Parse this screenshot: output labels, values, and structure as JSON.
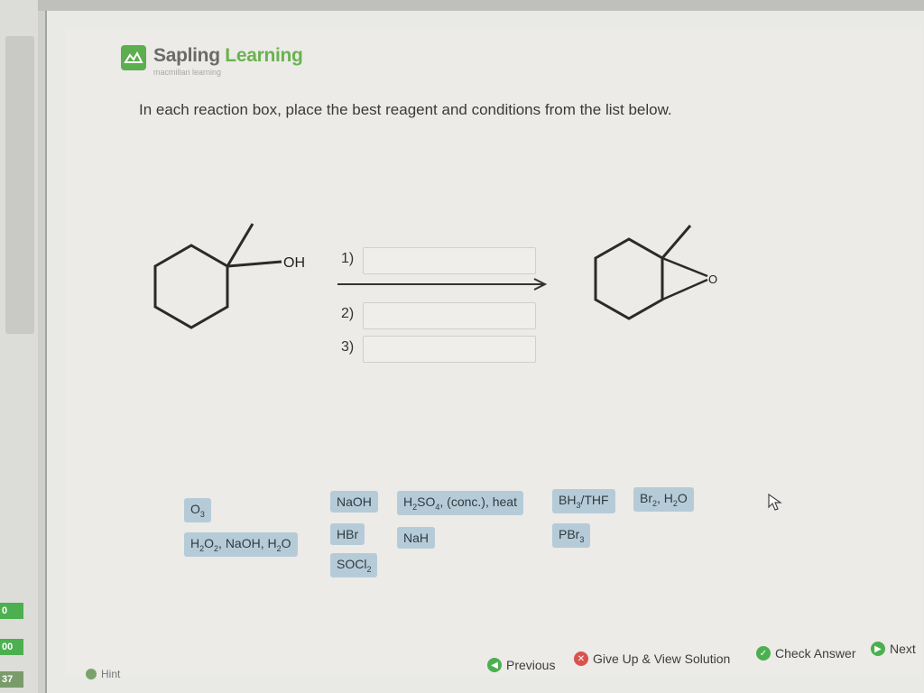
{
  "brand": {
    "name_part1": "Sapling",
    "name_part2": "Learning",
    "tagline": "macmillan learning"
  },
  "question": {
    "prompt": "In each reaction box, place the best reagent and conditions from the list below."
  },
  "reaction": {
    "reactant_label": "OH",
    "product_label": "O",
    "steps": [
      {
        "label": "1)",
        "value": ""
      },
      {
        "label": "2)",
        "value": ""
      },
      {
        "label": "3)",
        "value": ""
      }
    ]
  },
  "reagents": [
    {
      "id": "o3",
      "label": "O3"
    },
    {
      "id": "h2o2",
      "label": "H2O2, NaOH, H2O"
    },
    {
      "id": "naoh",
      "label": "NaOH"
    },
    {
      "id": "hbr",
      "label": "HBr"
    },
    {
      "id": "socl2",
      "label": "SOCl2"
    },
    {
      "id": "h2so4",
      "label": "H2SO4, (conc.), heat"
    },
    {
      "id": "nah",
      "label": "NaH"
    },
    {
      "id": "bh3",
      "label": "BH3/THF"
    },
    {
      "id": "pbr3",
      "label": "PBr3"
    },
    {
      "id": "br2",
      "label": "Br2, H2O"
    }
  ],
  "navigation": {
    "previous": "Previous",
    "give_up": "Give Up & View Solution",
    "check": "Check Answer",
    "next": "Next",
    "hint": "Hint"
  },
  "sidebar_badges": [
    "0",
    "00",
    "37"
  ],
  "colors": {
    "brand_green": "#6ab24f",
    "chip_bg": "#b6cbd8",
    "nav_green": "#4caf50",
    "nav_red": "#d9534f"
  }
}
